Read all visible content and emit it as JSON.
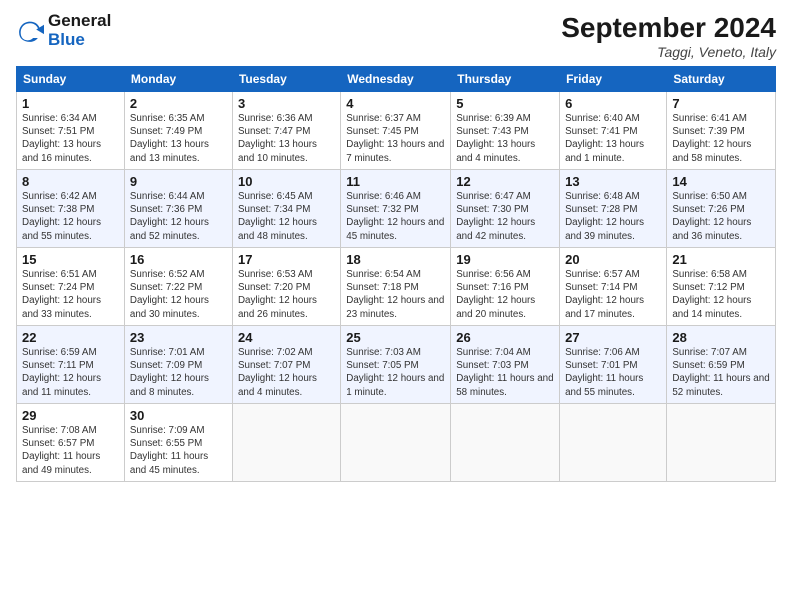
{
  "header": {
    "logo_line1": "General",
    "logo_line2": "Blue",
    "month_title": "September 2024",
    "location": "Taggi, Veneto, Italy"
  },
  "days_of_week": [
    "Sunday",
    "Monday",
    "Tuesday",
    "Wednesday",
    "Thursday",
    "Friday",
    "Saturday"
  ],
  "weeks": [
    [
      {
        "num": "1",
        "sunrise": "6:34 AM",
        "sunset": "7:51 PM",
        "daylight": "13 hours and 16 minutes."
      },
      {
        "num": "2",
        "sunrise": "6:35 AM",
        "sunset": "7:49 PM",
        "daylight": "13 hours and 13 minutes."
      },
      {
        "num": "3",
        "sunrise": "6:36 AM",
        "sunset": "7:47 PM",
        "daylight": "13 hours and 10 minutes."
      },
      {
        "num": "4",
        "sunrise": "6:37 AM",
        "sunset": "7:45 PM",
        "daylight": "13 hours and 7 minutes."
      },
      {
        "num": "5",
        "sunrise": "6:39 AM",
        "sunset": "7:43 PM",
        "daylight": "13 hours and 4 minutes."
      },
      {
        "num": "6",
        "sunrise": "6:40 AM",
        "sunset": "7:41 PM",
        "daylight": "13 hours and 1 minute."
      },
      {
        "num": "7",
        "sunrise": "6:41 AM",
        "sunset": "7:39 PM",
        "daylight": "12 hours and 58 minutes."
      }
    ],
    [
      {
        "num": "8",
        "sunrise": "6:42 AM",
        "sunset": "7:38 PM",
        "daylight": "12 hours and 55 minutes."
      },
      {
        "num": "9",
        "sunrise": "6:44 AM",
        "sunset": "7:36 PM",
        "daylight": "12 hours and 52 minutes."
      },
      {
        "num": "10",
        "sunrise": "6:45 AM",
        "sunset": "7:34 PM",
        "daylight": "12 hours and 48 minutes."
      },
      {
        "num": "11",
        "sunrise": "6:46 AM",
        "sunset": "7:32 PM",
        "daylight": "12 hours and 45 minutes."
      },
      {
        "num": "12",
        "sunrise": "6:47 AM",
        "sunset": "7:30 PM",
        "daylight": "12 hours and 42 minutes."
      },
      {
        "num": "13",
        "sunrise": "6:48 AM",
        "sunset": "7:28 PM",
        "daylight": "12 hours and 39 minutes."
      },
      {
        "num": "14",
        "sunrise": "6:50 AM",
        "sunset": "7:26 PM",
        "daylight": "12 hours and 36 minutes."
      }
    ],
    [
      {
        "num": "15",
        "sunrise": "6:51 AM",
        "sunset": "7:24 PM",
        "daylight": "12 hours and 33 minutes."
      },
      {
        "num": "16",
        "sunrise": "6:52 AM",
        "sunset": "7:22 PM",
        "daylight": "12 hours and 30 minutes."
      },
      {
        "num": "17",
        "sunrise": "6:53 AM",
        "sunset": "7:20 PM",
        "daylight": "12 hours and 26 minutes."
      },
      {
        "num": "18",
        "sunrise": "6:54 AM",
        "sunset": "7:18 PM",
        "daylight": "12 hours and 23 minutes."
      },
      {
        "num": "19",
        "sunrise": "6:56 AM",
        "sunset": "7:16 PM",
        "daylight": "12 hours and 20 minutes."
      },
      {
        "num": "20",
        "sunrise": "6:57 AM",
        "sunset": "7:14 PM",
        "daylight": "12 hours and 17 minutes."
      },
      {
        "num": "21",
        "sunrise": "6:58 AM",
        "sunset": "7:12 PM",
        "daylight": "12 hours and 14 minutes."
      }
    ],
    [
      {
        "num": "22",
        "sunrise": "6:59 AM",
        "sunset": "7:11 PM",
        "daylight": "12 hours and 11 minutes."
      },
      {
        "num": "23",
        "sunrise": "7:01 AM",
        "sunset": "7:09 PM",
        "daylight": "12 hours and 8 minutes."
      },
      {
        "num": "24",
        "sunrise": "7:02 AM",
        "sunset": "7:07 PM",
        "daylight": "12 hours and 4 minutes."
      },
      {
        "num": "25",
        "sunrise": "7:03 AM",
        "sunset": "7:05 PM",
        "daylight": "12 hours and 1 minute."
      },
      {
        "num": "26",
        "sunrise": "7:04 AM",
        "sunset": "7:03 PM",
        "daylight": "11 hours and 58 minutes."
      },
      {
        "num": "27",
        "sunrise": "7:06 AM",
        "sunset": "7:01 PM",
        "daylight": "11 hours and 55 minutes."
      },
      {
        "num": "28",
        "sunrise": "7:07 AM",
        "sunset": "6:59 PM",
        "daylight": "11 hours and 52 minutes."
      }
    ],
    [
      {
        "num": "29",
        "sunrise": "7:08 AM",
        "sunset": "6:57 PM",
        "daylight": "11 hours and 49 minutes."
      },
      {
        "num": "30",
        "sunrise": "7:09 AM",
        "sunset": "6:55 PM",
        "daylight": "11 hours and 45 minutes."
      },
      null,
      null,
      null,
      null,
      null
    ]
  ]
}
